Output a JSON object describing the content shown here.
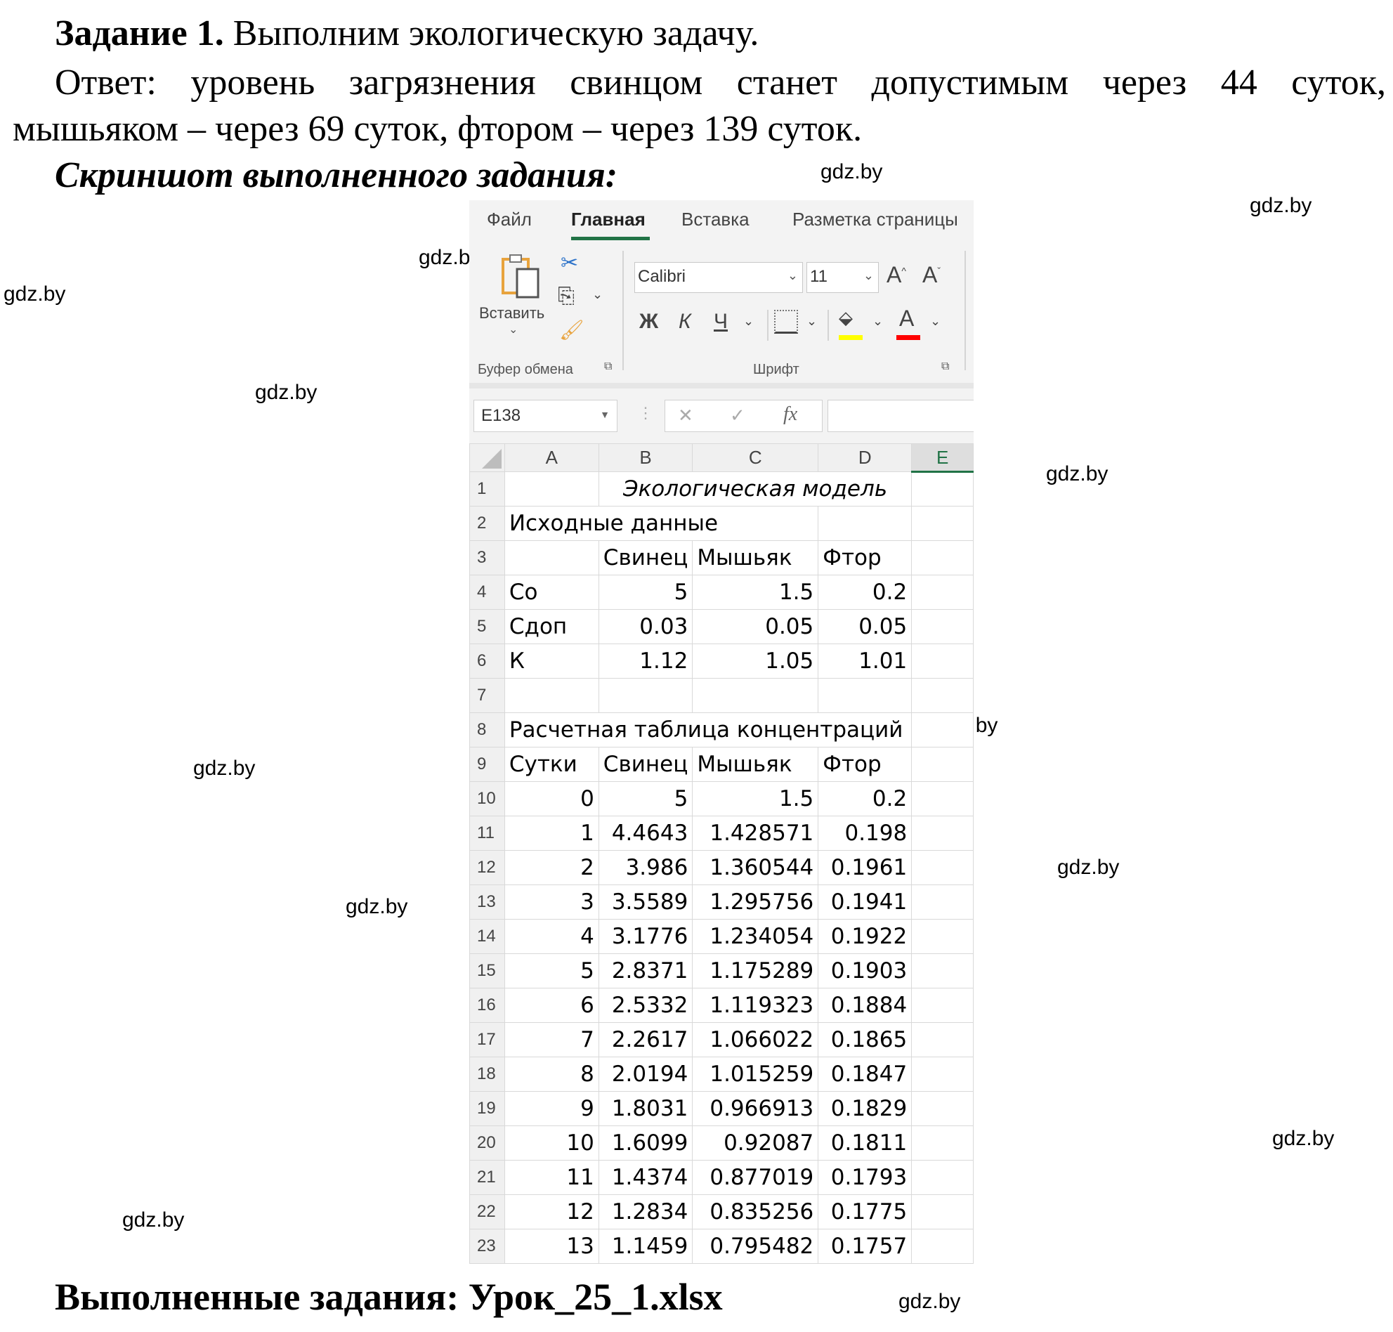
{
  "document": {
    "task_heading_bold": "Задание 1.",
    "task_heading_text": "Выполним экологическую задачу.",
    "answer_line1_words": [
      "Ответ:",
      "уровень",
      "загрязнения",
      "свинцом",
      "станет",
      "допустимым",
      "через",
      "44",
      "суток,"
    ],
    "answer_line2": "мышьяком – через 69 суток, фтором – через 139 суток.",
    "screenshot_heading": "Скриншот выполненного задания:",
    "footer": "Выполненные задания: Урок_25_1.xlsx",
    "watermark": "gdz.by"
  },
  "excel": {
    "tabs": [
      {
        "label": "Файл",
        "active": false
      },
      {
        "label": "Главная",
        "active": true
      },
      {
        "label": "Вставка",
        "active": false
      },
      {
        "label": "Разметка страницы",
        "active": false
      }
    ],
    "ribbon": {
      "paste_label": "Вставить",
      "clipboard_group": "Буфер обмена",
      "font_group": "Шрифт",
      "font_name": "Calibri",
      "font_size": "11",
      "bold_glyph": "Ж",
      "italic_glyph": "К",
      "underline_glyph": "Ч",
      "grow_font_glyph": "A",
      "shrink_font_glyph": "A",
      "font_color_glyph": "A",
      "fill_color": "#ffff00",
      "font_color": "#ff0000"
    },
    "formula_bar": {
      "name_box": "E138",
      "cancel_glyph": "✕",
      "enter_glyph": "✓",
      "fx_label": "fx",
      "formula": ""
    },
    "columns": [
      "A",
      "B",
      "C",
      "D",
      "E"
    ],
    "selected_column": "E",
    "rows": [
      {
        "n": "1",
        "cells": [
          "",
          "Экологическая модель",
          "",
          "",
          ""
        ]
      },
      {
        "n": "2",
        "cells": [
          "Исходные данные",
          "",
          "",
          "",
          ""
        ]
      },
      {
        "n": "3",
        "cells": [
          "",
          "Свинец",
          "Мышьяк",
          "Фтор",
          ""
        ]
      },
      {
        "n": "4",
        "cells": [
          "Co",
          "5",
          "1.5",
          "0.2",
          ""
        ]
      },
      {
        "n": "5",
        "cells": [
          "Сдоп",
          "0.03",
          "0.05",
          "0.05",
          ""
        ]
      },
      {
        "n": "6",
        "cells": [
          "К",
          "1.12",
          "1.05",
          "1.01",
          ""
        ]
      },
      {
        "n": "7",
        "cells": [
          "",
          "",
          "",
          "",
          ""
        ]
      },
      {
        "n": "8",
        "cells": [
          "Расчетная таблица концентраций",
          "",
          "",
          "",
          ""
        ]
      },
      {
        "n": "9",
        "cells": [
          "Сутки",
          "Свинец",
          "Мышьяк",
          "Фтор",
          ""
        ]
      },
      {
        "n": "10",
        "cells": [
          "0",
          "5",
          "1.5",
          "0.2",
          ""
        ]
      },
      {
        "n": "11",
        "cells": [
          "1",
          "4.4643",
          "1.428571",
          "0.198",
          ""
        ]
      },
      {
        "n": "12",
        "cells": [
          "2",
          "3.986",
          "1.360544",
          "0.1961",
          ""
        ]
      },
      {
        "n": "13",
        "cells": [
          "3",
          "3.5589",
          "1.295756",
          "0.1941",
          ""
        ]
      },
      {
        "n": "14",
        "cells": [
          "4",
          "3.1776",
          "1.234054",
          "0.1922",
          ""
        ]
      },
      {
        "n": "15",
        "cells": [
          "5",
          "2.8371",
          "1.175289",
          "0.1903",
          ""
        ]
      },
      {
        "n": "16",
        "cells": [
          "6",
          "2.5332",
          "1.119323",
          "0.1884",
          ""
        ]
      },
      {
        "n": "17",
        "cells": [
          "7",
          "2.2617",
          "1.066022",
          "0.1865",
          ""
        ]
      },
      {
        "n": "18",
        "cells": [
          "8",
          "2.0194",
          "1.015259",
          "0.1847",
          ""
        ]
      },
      {
        "n": "19",
        "cells": [
          "9",
          "1.8031",
          "0.966913",
          "0.1829",
          ""
        ]
      },
      {
        "n": "20",
        "cells": [
          "10",
          "1.6099",
          "0.92087",
          "0.1811",
          ""
        ]
      },
      {
        "n": "21",
        "cells": [
          "11",
          "1.4374",
          "0.877019",
          "0.1793",
          ""
        ]
      },
      {
        "n": "22",
        "cells": [
          "12",
          "1.2834",
          "0.835256",
          "0.1775",
          ""
        ]
      },
      {
        "n": "23",
        "cells": [
          "13",
          "1.1459",
          "0.795482",
          "0.1757",
          ""
        ]
      }
    ]
  }
}
